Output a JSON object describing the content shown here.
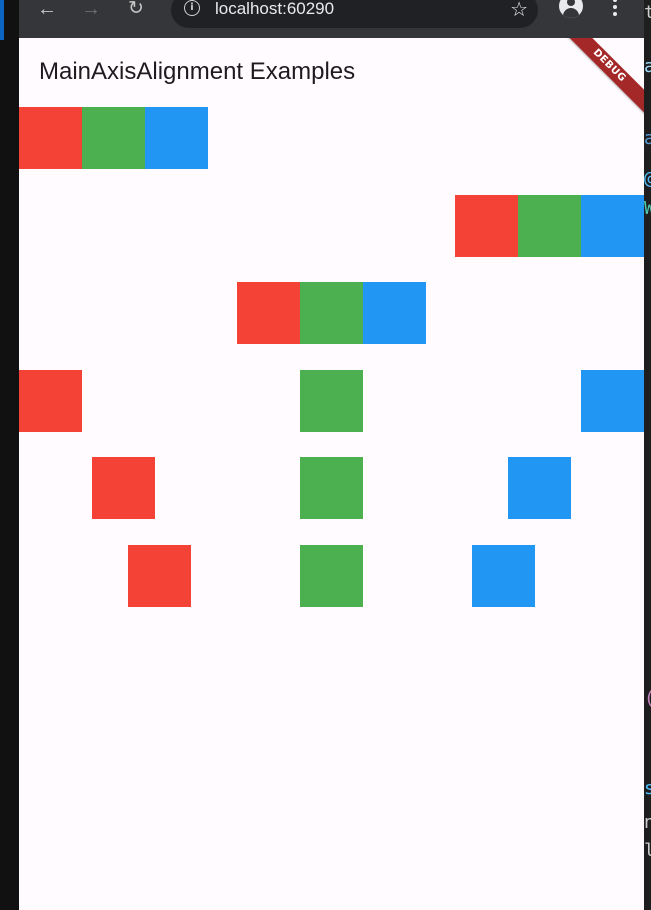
{
  "browser": {
    "url": "localhost:60290",
    "back_icon": "←",
    "forward_icon": "→",
    "reload_icon": "↻",
    "info_icon": "i",
    "star_icon": "☆"
  },
  "app": {
    "title": "MainAxisAlignment Examples",
    "debug_label": "DEBUG",
    "colors": {
      "red": "#f44336",
      "green": "#4caf50",
      "blue": "#2196f3",
      "background": "#fffbfe"
    },
    "rows": [
      {
        "alignment": "start",
        "boxes": [
          "red",
          "green",
          "blue"
        ]
      },
      {
        "alignment": "end",
        "boxes": [
          "red",
          "green",
          "blue"
        ]
      },
      {
        "alignment": "center",
        "boxes": [
          "red",
          "green",
          "blue"
        ]
      },
      {
        "alignment": "spaceBetween",
        "boxes": [
          "red",
          "green",
          "blue"
        ]
      },
      {
        "alignment": "spaceAround",
        "boxes": [
          "red",
          "green",
          "blue"
        ]
      },
      {
        "alignment": "spaceEvenly",
        "boxes": [
          "red",
          "green",
          "blue"
        ]
      }
    ]
  },
  "editor_edge": {
    "glyphs": [
      "t",
      "a",
      "a",
      "@",
      "W",
      "(",
      "s",
      "n",
      "l"
    ]
  }
}
